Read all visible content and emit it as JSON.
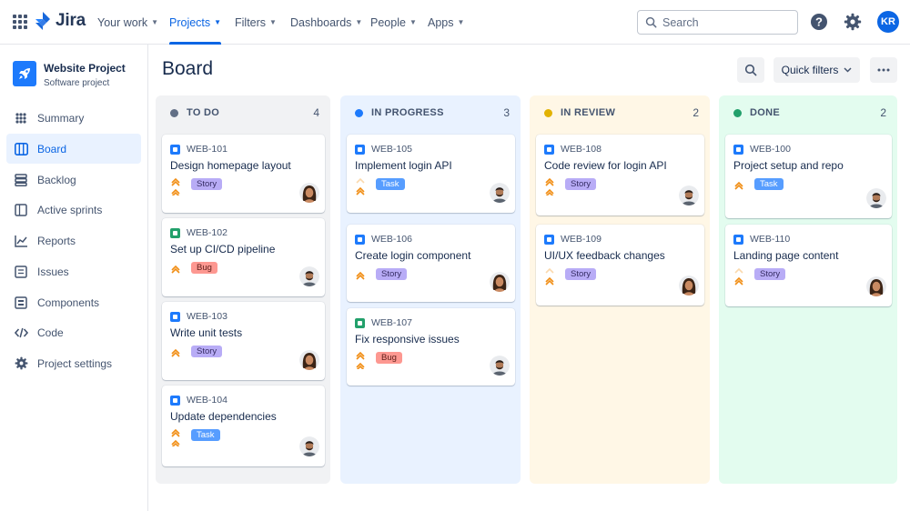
{
  "topnav": {
    "logo": "Jira",
    "items": [
      {
        "label": "Your work",
        "active": false
      },
      {
        "label": "Projects",
        "active": true
      },
      {
        "label": "Filters",
        "active": false
      },
      {
        "label": "Dashboards",
        "active": false
      },
      {
        "label": "People",
        "active": false
      },
      {
        "label": "Apps",
        "active": false
      }
    ],
    "search_placeholder": "Search",
    "avatar_initials": "KR"
  },
  "sidebar": {
    "project_name": "Website Project",
    "project_type": "Software project",
    "items": [
      {
        "label": "Summary",
        "icon": "summary-icon"
      },
      {
        "label": "Board",
        "icon": "board-icon",
        "active": true
      },
      {
        "label": "Backlog",
        "icon": "backlog-icon"
      },
      {
        "label": "Active sprints",
        "icon": "sprints-icon"
      },
      {
        "label": "Reports",
        "icon": "reports-icon"
      },
      {
        "label": "Issues",
        "icon": "issues-icon"
      },
      {
        "label": "Components",
        "icon": "components-icon"
      },
      {
        "label": "Code",
        "icon": "code-icon"
      },
      {
        "label": "Project settings",
        "icon": "settings-icon"
      }
    ]
  },
  "board": {
    "title": "Board",
    "quick_filters_label": "Quick filters",
    "columns": [
      {
        "title": "TO DO",
        "count": "4",
        "dot_color": "#626f86",
        "bg": "#f1f2f4",
        "cards": [
          {
            "key": "WEB-101",
            "title": "Design homepage layout",
            "type": "story",
            "badge": "Story",
            "priority": "high",
            "assignee": "female"
          },
          {
            "key": "WEB-102",
            "title": "Set up CI/CD pipeline",
            "type": "bug",
            "badge": "Bug",
            "priority": "medium",
            "assignee": "male"
          },
          {
            "key": "WEB-103",
            "title": "Write unit tests",
            "type": "story",
            "badge": "Story",
            "priority": "medium",
            "assignee": "female"
          },
          {
            "key": "WEB-104",
            "title": "Update dependencies",
            "type": "task",
            "badge": "Task",
            "priority": "high",
            "assignee": "male"
          }
        ]
      },
      {
        "title": "IN PROGRESS",
        "count": "3",
        "dot_color": "#1d7afc",
        "bg": "#e9f2ff",
        "cards": [
          {
            "key": "WEB-105",
            "title": "Implement login API",
            "type": "task",
            "badge": "Task",
            "priority": "low",
            "assignee": "male"
          },
          {
            "key": "WEB-106",
            "title": "Create login component",
            "type": "story",
            "badge": "Story",
            "priority": "medium",
            "assignee": "female"
          },
          {
            "key": "WEB-107",
            "title": "Fix responsive issues",
            "type": "bug",
            "badge": "Bug",
            "priority": "high",
            "assignee": "male"
          }
        ]
      },
      {
        "title": "IN REVIEW",
        "count": "2",
        "dot_color": "#e2b203",
        "bg": "#fff7e6",
        "cards": [
          {
            "key": "WEB-108",
            "title": "Code review for login API",
            "type": "story",
            "badge": "Story",
            "priority": "high",
            "assignee": "male"
          },
          {
            "key": "WEB-109",
            "title": "UI/UX feedback changes",
            "type": "story",
            "badge": "Story",
            "priority": "low",
            "assignee": "female"
          }
        ]
      },
      {
        "title": "DONE",
        "count": "2",
        "dot_color": "#22a06b",
        "bg": "#e3fcef",
        "cards": [
          {
            "key": "WEB-100",
            "title": "Project setup and repo",
            "type": "task",
            "badge": "Task",
            "priority": "medium",
            "assignee": "male"
          },
          {
            "key": "WEB-110",
            "title": "Landing page content",
            "type": "story",
            "badge": "Story",
            "priority": "low",
            "assignee": "female"
          }
        ]
      }
    ]
  },
  "colors": {
    "accent": "#0c66e4",
    "story_icon": "#1d7afc",
    "bug_icon": "#22a06b",
    "task_icon": "#1d7afc",
    "priority": "#f18d13"
  }
}
